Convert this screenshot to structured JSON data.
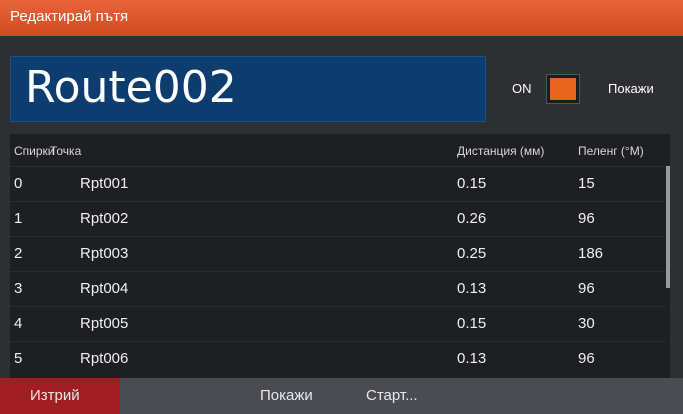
{
  "window": {
    "title": "Редактирай пътя"
  },
  "route": {
    "name": "Route002"
  },
  "visibility": {
    "toggle_label": "ON",
    "toggle_on": true,
    "show_label": "Покажи",
    "accent": "#e8641e"
  },
  "table": {
    "headers": {
      "index": "Спирки",
      "point": "Точка",
      "distance": "Дистанция (мм)",
      "bearing": "Пеленг (°M)"
    },
    "rows": [
      {
        "index": "0",
        "point": "Rpt001",
        "distance": "0.15",
        "bearing": "15"
      },
      {
        "index": "1",
        "point": "Rpt002",
        "distance": "0.26",
        "bearing": "96"
      },
      {
        "index": "2",
        "point": "Rpt003",
        "distance": "0.25",
        "bearing": "186"
      },
      {
        "index": "3",
        "point": "Rpt004",
        "distance": "0.13",
        "bearing": "96"
      },
      {
        "index": "4",
        "point": "Rpt005",
        "distance": "0.15",
        "bearing": "30"
      },
      {
        "index": "5",
        "point": "Rpt006",
        "distance": "0.13",
        "bearing": "96"
      }
    ]
  },
  "toolbar": {
    "delete_label": "Изтрий",
    "show_label": "Покажи",
    "start_label": "Старт..."
  }
}
